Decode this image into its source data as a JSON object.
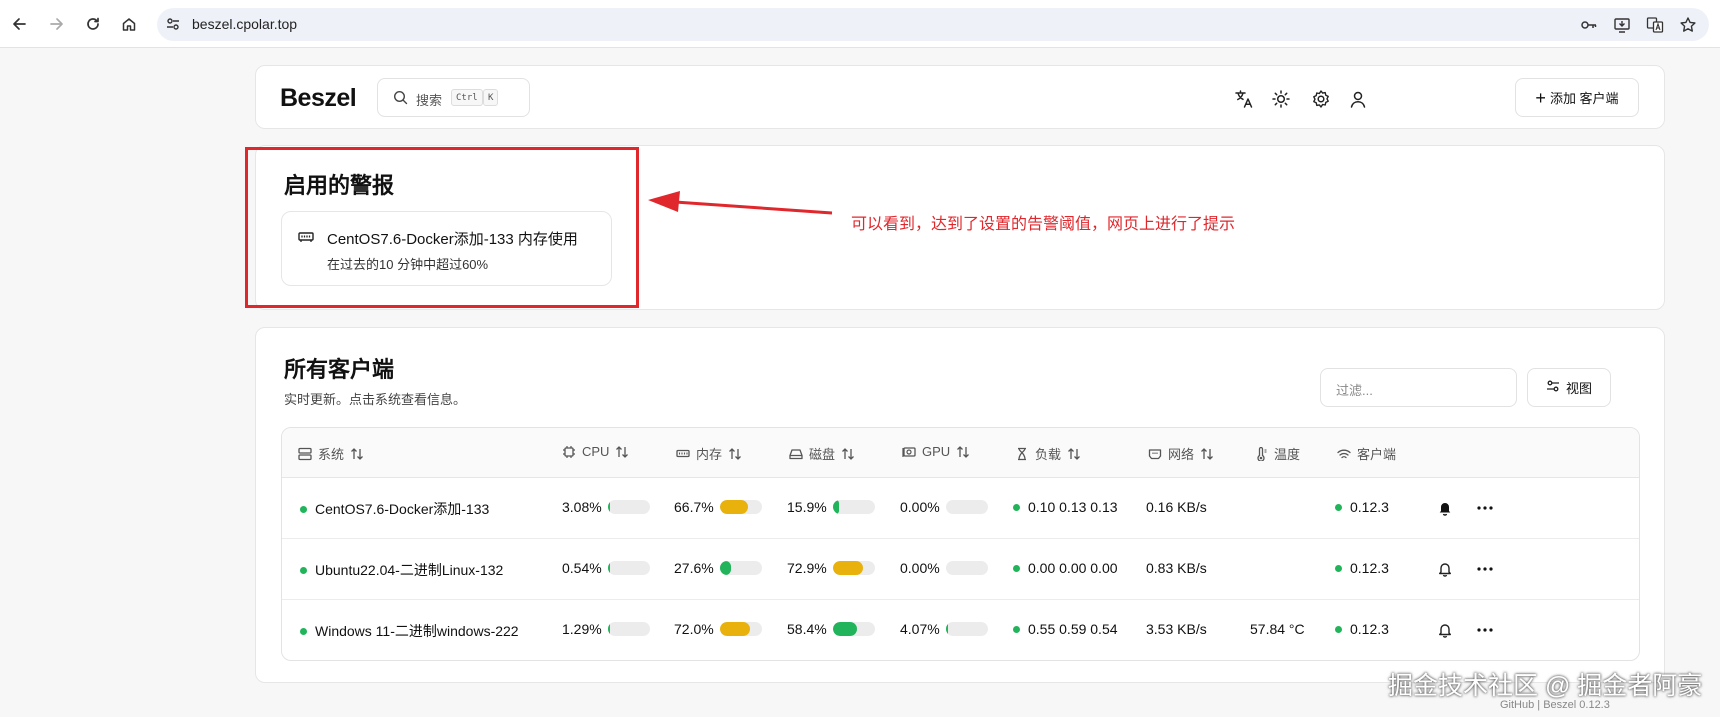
{
  "browser": {
    "url": "beszel.cpolar.top",
    "icons": [
      "back-icon",
      "forward-icon",
      "reload-icon",
      "home-icon",
      "site-settings-icon",
      "password-key-icon",
      "install-app-icon",
      "translate-page-icon",
      "bookmark-star-icon"
    ]
  },
  "header": {
    "logo": "Beszel",
    "search_label": "搜索",
    "search_kbd_1": "Ctrl",
    "search_kbd_2": "K",
    "add_client_label": "添加 客户端",
    "icons": [
      "language-icon",
      "theme-icon",
      "settings-icon",
      "user-icon"
    ]
  },
  "alerts": {
    "title": "启用的警报",
    "items": [
      {
        "title": "CentOS7.6-Docker添加-133 内存使用",
        "description": "在过去的10 分钟中超过60%"
      }
    ]
  },
  "annotation": {
    "text": "可以看到，达到了设置的告警阈值，网页上进行了提示",
    "color": "#e0272c"
  },
  "clients": {
    "title": "所有客户端",
    "subtitle": "实时更新。点击系统查看信息。",
    "filter_placeholder": "过滤...",
    "view_label": "视图",
    "columns": [
      "系统",
      "CPU",
      "内存",
      "磁盘",
      "GPU",
      "负载",
      "网络",
      "温度",
      "客户端"
    ],
    "rows": [
      {
        "name": "CentOS7.6-Docker添加-133",
        "cpu": "3.08%",
        "cpu_pct": 3.08,
        "mem": "66.7%",
        "mem_pct": 66.7,
        "disk": "15.9%",
        "disk_pct": 15.9,
        "gpu": "0.00%",
        "gpu_pct": 0,
        "load": "0.10 0.13 0.13",
        "net": "0.16 KB/s",
        "temp": "",
        "agent": "0.12.3",
        "alert_active": true
      },
      {
        "name": "Ubuntu22.04-二进制Linux-132",
        "cpu": "0.54%",
        "cpu_pct": 0.54,
        "mem": "27.6%",
        "mem_pct": 27.6,
        "disk": "72.9%",
        "disk_pct": 72.9,
        "gpu": "0.00%",
        "gpu_pct": 0,
        "load": "0.00 0.00 0.00",
        "net": "0.83 KB/s",
        "temp": "",
        "agent": "0.12.3",
        "alert_active": false
      },
      {
        "name": "Windows 11-二进制windows-222",
        "cpu": "1.29%",
        "cpu_pct": 1.29,
        "mem": "72.0%",
        "mem_pct": 72.0,
        "disk": "58.4%",
        "disk_pct": 58.4,
        "gpu": "4.07%",
        "gpu_pct": 4.07,
        "load": "0.55 0.59 0.54",
        "net": "3.53 KB/s",
        "temp": "57.84 °C",
        "agent": "0.12.3",
        "alert_active": false
      }
    ],
    "colors": {
      "status_green": "#22b45a",
      "bar_yellow": "#e8b10c",
      "bar_green": "#22b45a",
      "bar_track": "#ececec"
    }
  },
  "watermark": "掘金技术社区 @ 掘金者阿豪",
  "footer": "GitHub | Beszel 0.12.3"
}
